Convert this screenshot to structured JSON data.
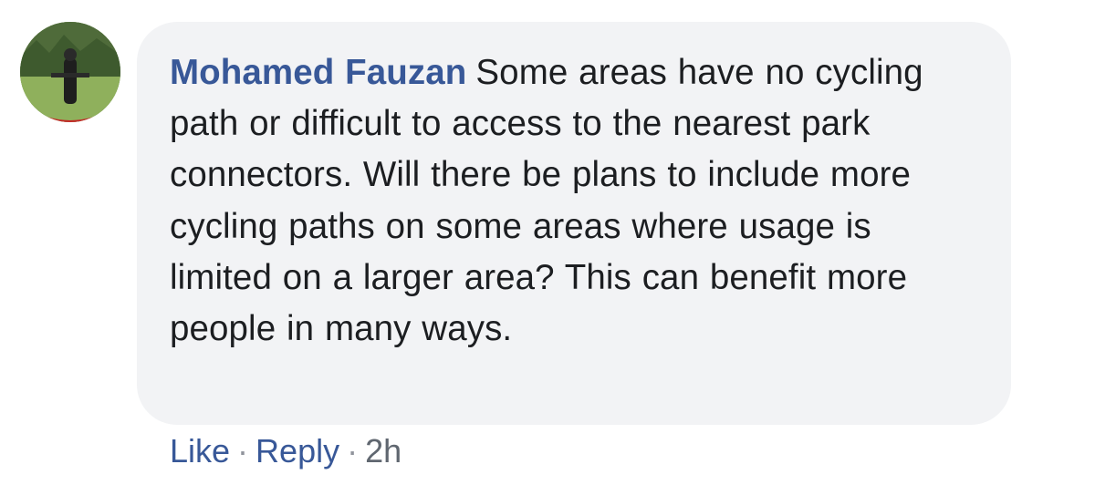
{
  "comment": {
    "author_name": "Mohamed Fauzan",
    "text": "Some areas have no cycling path or difficult to access to the nearest park connectors. Will there be plans to include more cycling paths on some areas where usage is limited on a larger area? This can benefit more people in many ways."
  },
  "actions": {
    "like_label": "Like",
    "reply_label": "Reply",
    "separator": "·",
    "timestamp": "2h"
  },
  "colors": {
    "author": "#385898",
    "bubble_bg": "#f2f3f5",
    "text": "#1c1e21"
  }
}
